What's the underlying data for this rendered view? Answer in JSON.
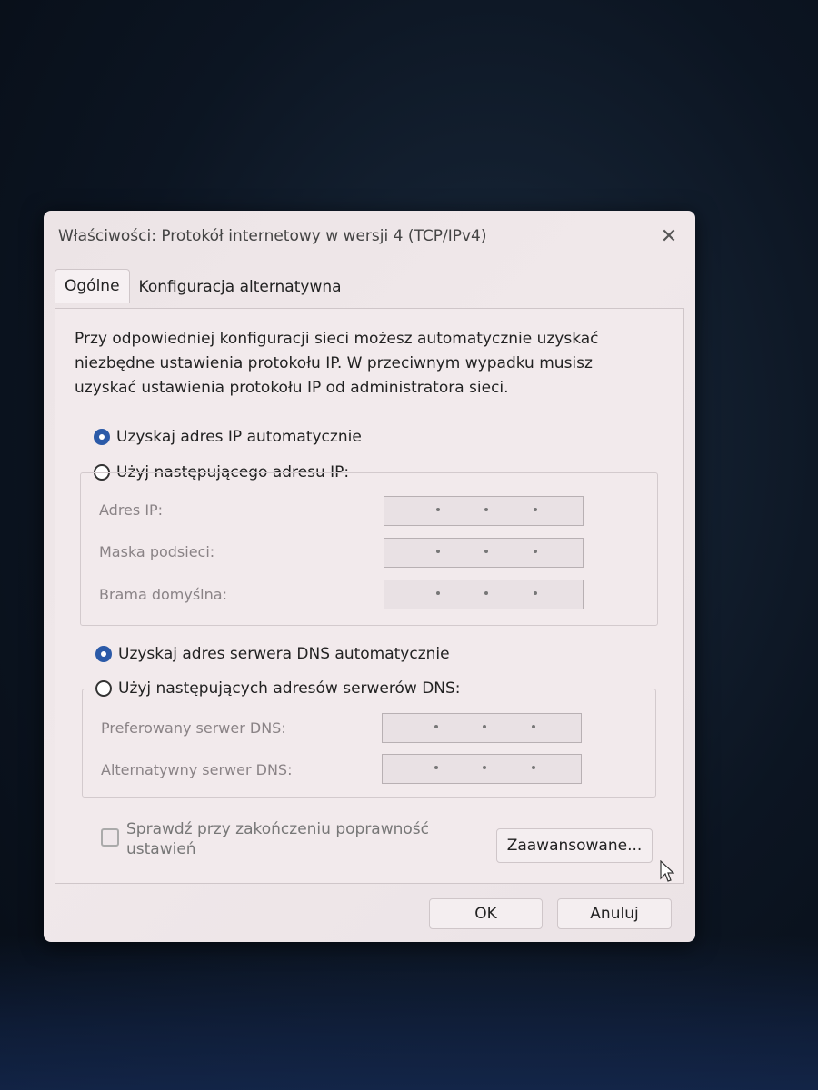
{
  "window": {
    "title": "Właściwości: Protokół internetowy w wersji 4 (TCP/IPv4)",
    "close_glyph": "✕"
  },
  "tabs": [
    {
      "label": "Ogólne",
      "active": true
    },
    {
      "label": "Konfiguracja alternatywna",
      "active": false
    }
  ],
  "description": "Przy odpowiedniej konfiguracji sieci możesz automatycznie uzyskać niezbędne ustawienia protokołu IP. W przeciwnym wypadku musisz uzyskać ustawienia protokołu IP od administratora sieci.",
  "ip_section": {
    "auto_label": "Uzyskaj adres IP automatycznie",
    "auto_selected": true,
    "manual_label": "Użyj następującego adresu IP:",
    "fields": [
      {
        "label": "Adres IP:",
        "value": ""
      },
      {
        "label": "Maska podsieci:",
        "value": ""
      },
      {
        "label": "Brama domyślna:",
        "value": ""
      }
    ]
  },
  "dns_section": {
    "auto_label": "Uzyskaj adres serwera DNS automatycznie",
    "auto_selected": true,
    "manual_label": "Użyj następujących adresów serwerów DNS:",
    "fields": [
      {
        "label": "Preferowany serwer DNS:",
        "value": ""
      },
      {
        "label": "Alternatywny serwer DNS:",
        "value": ""
      }
    ]
  },
  "validate_checkbox": {
    "label": "Sprawdź przy zakończeniu poprawność ustawień",
    "checked": false
  },
  "buttons": {
    "advanced": "Zaawansowane...",
    "ok": "OK",
    "cancel": "Anuluj"
  },
  "colors": {
    "accent": "#2b5aa8",
    "dialog_bg": "#ece4e6"
  }
}
